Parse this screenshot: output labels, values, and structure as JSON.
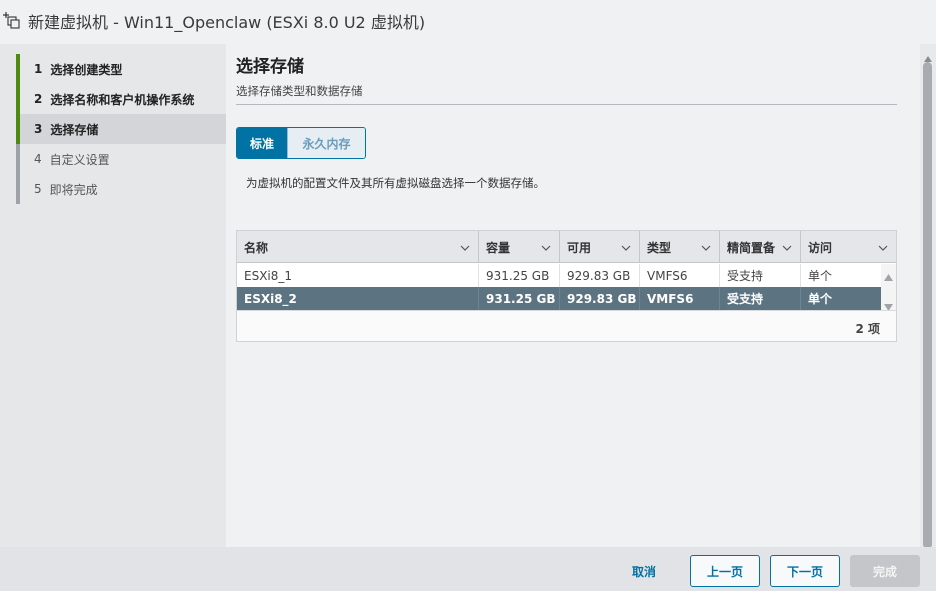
{
  "window": {
    "title": "新建虚拟机 - Win11_Openclaw (ESXi 8.0 U2 虚拟机)",
    "icon": "new-vm-icon"
  },
  "steps": [
    {
      "num": "1",
      "label": "选择创建类型",
      "state": "done"
    },
    {
      "num": "2",
      "label": "选择名称和客户机操作系统",
      "state": "done"
    },
    {
      "num": "3",
      "label": "选择存储",
      "state": "current"
    },
    {
      "num": "4",
      "label": "自定义设置",
      "state": "pending"
    },
    {
      "num": "5",
      "label": "即将完成",
      "state": "pending"
    }
  ],
  "main": {
    "title": "选择存储",
    "subtitle": "选择存储类型和数据存储",
    "tabs": [
      {
        "label": "标准",
        "active": true
      },
      {
        "label": "永久内存",
        "active": false
      }
    ],
    "hint": "为虚拟机的配置文件及其所有虚拟磁盘选择一个数据存储。"
  },
  "grid": {
    "columns": [
      "名称",
      "容量",
      "可用",
      "类型",
      "精简置备",
      "访问"
    ],
    "rows": [
      [
        "ESXi8_1",
        "931.25 GB",
        "929.83 GB",
        "VMFS6",
        "受支持",
        "单个"
      ],
      [
        "ESXi8_2",
        "931.25 GB",
        "929.83 GB",
        "VMFS6",
        "受支持",
        "单个"
      ]
    ],
    "selected_row": 1,
    "count": "2 项"
  },
  "footer": {
    "cancel": "取消",
    "prev": "上一页",
    "next": "下一页",
    "finish": "完成"
  },
  "colors": {
    "accent": "#0072a3",
    "step_done": "#4f8a10",
    "selected_row": "#5c7382"
  }
}
